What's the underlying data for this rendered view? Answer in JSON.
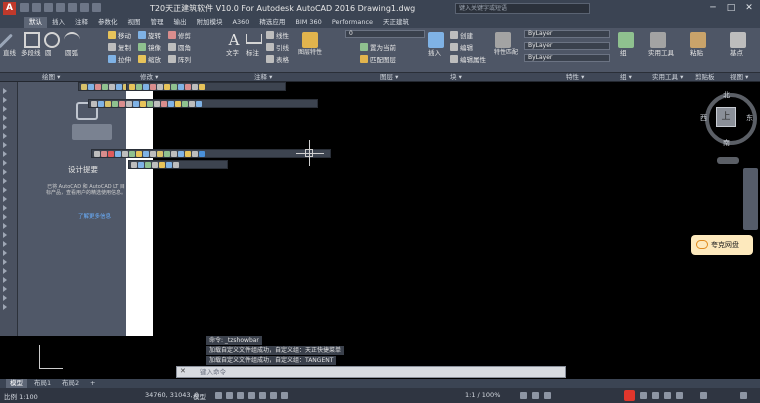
{
  "title_bar": {
    "app_icon": "A",
    "title": "T20天正建筑软件 V10.0 For Autodesk AutoCAD 2016    Drawing1.dwg",
    "search_placeholder": "键入关键字或短语",
    "controls": [
      "─",
      "□",
      "✕"
    ]
  },
  "tabs": [
    "默认",
    "插入",
    "注释",
    "参数化",
    "视图",
    "管理",
    "输出",
    "附加模块",
    "A360",
    "精选应用",
    "BIM 360",
    "Performance",
    "天正建筑"
  ],
  "ribbon": {
    "draw": [
      "直线",
      "多段线",
      "圆",
      "圆弧"
    ],
    "modify": [
      "移动",
      "旋转",
      "修剪",
      "复制",
      "镜像",
      "圆角",
      "拉伸",
      "缩放",
      "阵列"
    ],
    "annotation": [
      "文字",
      "标注",
      "线性",
      "引线",
      "表格"
    ],
    "layers": {
      "properties": "图层特性",
      "layer_combo": "0",
      "buttons": [
        "置为当前",
        "匹配图层"
      ]
    },
    "block": {
      "insert": "插入",
      "buttons": [
        "创建",
        "编辑",
        "编辑属性"
      ]
    },
    "properties": {
      "match": "特性匹配",
      "combos": [
        "ByLayer",
        "ByLayer",
        "ByLayer"
      ]
    },
    "groups": "组",
    "utilities": "实用工具",
    "clipboard": "粘贴",
    "view": "基点"
  },
  "panel_titles": [
    "绘图 ▾",
    "修改 ▾",
    "注释 ▾",
    "图层 ▾",
    "块 ▾",
    "特性 ▾",
    "组 ▾",
    "实用工具 ▾",
    "剪贴板",
    "视图 ▾"
  ],
  "start_panel": {
    "heading": "设计提要",
    "body": "已将 AutoCAD 和 AutoCAD LT 目标产品，查看用户的精选使用信息。",
    "link": "了解更多信息"
  },
  "viewcube": {
    "north": "北",
    "south": "南",
    "east": "东",
    "west": "西",
    "center": "上"
  },
  "wcs": "WCS",
  "netdisk": "夸克网盘",
  "command_history": [
    "命令: _tzshowbar",
    "加载自定义文件组成功，自定义组：天正快捷菜单",
    "加载自定义文件组成功，自定义组：TANGENT"
  ],
  "command_prompt": "键入命令",
  "layout_tabs": [
    "模型",
    "布局1",
    "布局2",
    "+"
  ],
  "status": {
    "scale": "比例 1:100",
    "coords": "34760, 31043, 0",
    "mode": "模型",
    "annoscale": "1:1 / 100%"
  },
  "colors": {
    "titlebar": "#3b4453",
    "ribbon": "#4e5666",
    "canvas": "#000000",
    "netdisk_bg": "#fde9bd"
  }
}
